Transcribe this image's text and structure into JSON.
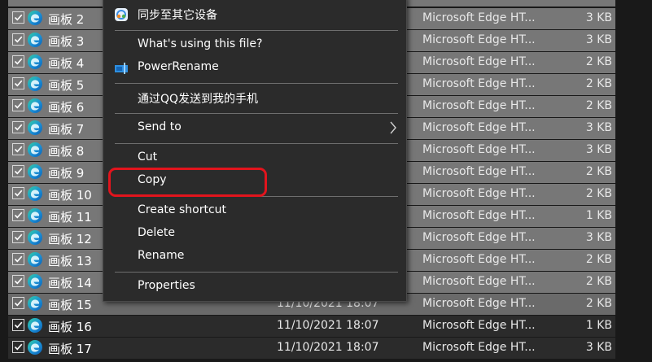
{
  "files": [
    {
      "name": "画板 2",
      "date": "",
      "type": "Microsoft Edge HT...",
      "size": "3 KB"
    },
    {
      "name": "画板 3",
      "date": "",
      "type": "Microsoft Edge HT...",
      "size": "3 KB"
    },
    {
      "name": "画板 4",
      "date": "",
      "type": "Microsoft Edge HT...",
      "size": "2 KB"
    },
    {
      "name": "画板 5",
      "date": "",
      "type": "Microsoft Edge HT...",
      "size": "2 KB"
    },
    {
      "name": "画板 6",
      "date": "",
      "type": "Microsoft Edge HT...",
      "size": "2 KB"
    },
    {
      "name": "画板 7",
      "date": "",
      "type": "Microsoft Edge HT...",
      "size": "3 KB"
    },
    {
      "name": "画板 8",
      "date": "",
      "type": "Microsoft Edge HT...",
      "size": "3 KB"
    },
    {
      "name": "画板 9",
      "date": "",
      "type": "Microsoft Edge HT...",
      "size": "2 KB"
    },
    {
      "name": "画板 10",
      "date": "",
      "type": "Microsoft Edge HT...",
      "size": "2 KB"
    },
    {
      "name": "画板 11",
      "date": "",
      "type": "Microsoft Edge HT...",
      "size": "1 KB"
    },
    {
      "name": "画板 12",
      "date": "",
      "type": "Microsoft Edge HT...",
      "size": "3 KB"
    },
    {
      "name": "画板 13",
      "date": "",
      "type": "Microsoft Edge HT...",
      "size": "2 KB"
    },
    {
      "name": "画板 14",
      "date": "",
      "type": "Microsoft Edge HT...",
      "size": "2 KB"
    },
    {
      "name": "画板 15",
      "date": "11/10/2021 18:07",
      "type": "Microsoft Edge HT...",
      "size": "2 KB"
    },
    {
      "name": "画板 16",
      "date": "11/10/2021 18:07",
      "type": "Microsoft Edge HT...",
      "size": "1 KB"
    },
    {
      "name": "画板 17",
      "date": "11/10/2021 18:07",
      "type": "Microsoft Edge HT...",
      "size": "3 KB"
    }
  ],
  "context_menu": {
    "sync": "同步至其它设备",
    "whats_using": "What's using this file?",
    "powerrename": "PowerRename",
    "qq_send": "通过QQ发送到我的手机",
    "send_to": "Send to",
    "cut": "Cut",
    "copy": "Copy",
    "create_shortcut": "Create shortcut",
    "delete": "Delete",
    "rename": "Rename",
    "properties": "Properties"
  },
  "colors": {
    "annotation": "#e2141d",
    "selected_row": "#777777",
    "menu_bg": "#2b2b2b"
  },
  "icons": {
    "file": "edge-icon",
    "sync": "sync-icon",
    "powerrename": "powerrename-icon",
    "submenu": "chevron-right-icon"
  }
}
